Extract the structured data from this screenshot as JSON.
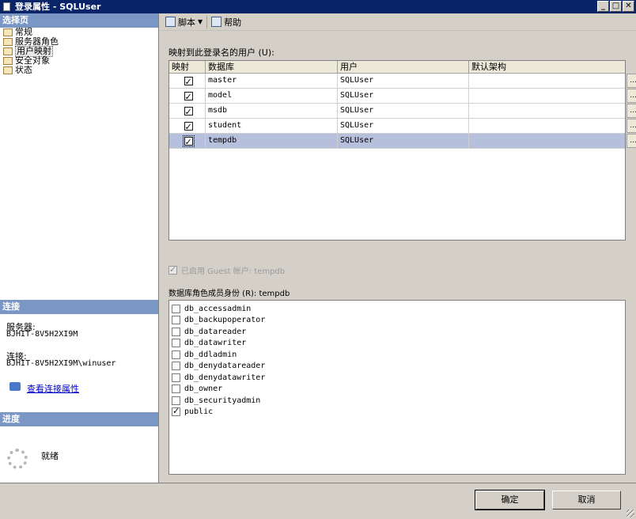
{
  "window": {
    "title": "登录属性 - SQLUser",
    "minimize": "_",
    "maximize": "□",
    "close": "✕"
  },
  "left": {
    "select_page_header": "选择页",
    "pages": [
      {
        "label": "常规",
        "icon": "page-icon"
      },
      {
        "label": "服务器角色",
        "icon": "page-icon"
      },
      {
        "label": "用户映射",
        "icon": "page-icon",
        "selected": true
      },
      {
        "label": "安全对象",
        "icon": "page-icon"
      },
      {
        "label": "状态",
        "icon": "page-icon"
      }
    ],
    "connection_header": "连接",
    "server_label": "服务器:",
    "server_value": "BJHIT-8V5H2XI9M",
    "connection_label": "连接:",
    "connection_value": "BJHIT-8V5H2XI9M\\winuser",
    "view_props_link": "查看连接属性",
    "progress_header": "进度",
    "progress_status": "就绪"
  },
  "toolbar": {
    "script_label": "脚本",
    "help_label": "帮助"
  },
  "mapping": {
    "label": "映射到此登录名的用户 (U):",
    "columns": [
      "映射",
      "数据库",
      "用户",
      "默认架构"
    ],
    "rows": [
      {
        "mapped": true,
        "database": "master",
        "user": "SQLUser",
        "schema": ""
      },
      {
        "mapped": true,
        "database": "model",
        "user": "SQLUser",
        "schema": ""
      },
      {
        "mapped": true,
        "database": "msdb",
        "user": "SQLUser",
        "schema": ""
      },
      {
        "mapped": true,
        "database": "student",
        "user": "SQLUser",
        "schema": ""
      },
      {
        "mapped": true,
        "database": "tempdb",
        "user": "SQLUser",
        "schema": "",
        "selected": true
      }
    ],
    "ellipsis": "..."
  },
  "guest": {
    "label": "已启用 Guest 帐户: tempdb",
    "checked": true,
    "enabled": false
  },
  "roles": {
    "label": "数据库角色成员身份 (R): tempdb",
    "items": [
      {
        "name": "db_accessadmin",
        "checked": false
      },
      {
        "name": "db_backupoperator",
        "checked": false
      },
      {
        "name": "db_datareader",
        "checked": false
      },
      {
        "name": "db_datawriter",
        "checked": false
      },
      {
        "name": "db_ddladmin",
        "checked": false
      },
      {
        "name": "db_denydatareader",
        "checked": false
      },
      {
        "name": "db_denydatawriter",
        "checked": false
      },
      {
        "name": "db_owner",
        "checked": false
      },
      {
        "name": "db_securityadmin",
        "checked": false
      },
      {
        "name": "public",
        "checked": true
      }
    ]
  },
  "buttons": {
    "ok": "确定",
    "cancel": "取消"
  },
  "colors": {
    "title_bar": "#0a246a",
    "section_header": "#7a96c4",
    "selected_row": "#b6bfdb",
    "link": "#0000cc"
  }
}
